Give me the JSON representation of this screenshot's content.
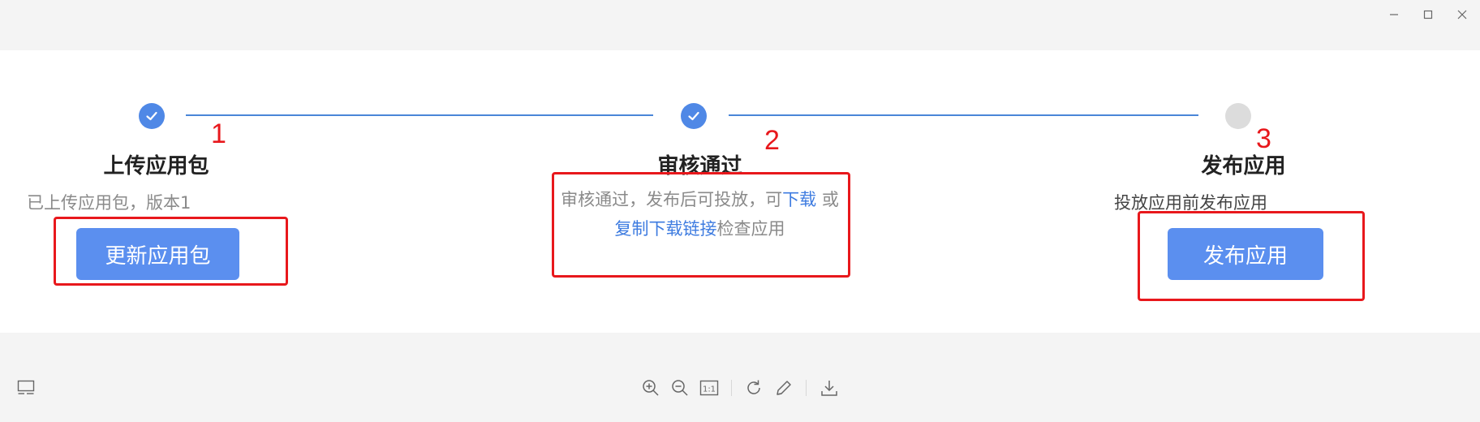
{
  "steps": [
    {
      "title": "上传应用包",
      "description": "已上传应用包，版本1",
      "button_label": "更新应用包",
      "status": "done",
      "annotation": "1"
    },
    {
      "title": "审核通过",
      "description_prefix": "审核通过，发布后可投放，可",
      "link_download": "下载",
      "description_or": " 或 ",
      "link_copy": "复制下载链接",
      "description_suffix": "检查应用",
      "status": "done",
      "annotation": "2"
    },
    {
      "title": "发布应用",
      "description": "投放应用前发布应用",
      "button_label": "发布应用",
      "status": "todo",
      "annotation": "3"
    }
  ],
  "colors": {
    "accent": "#4f88e6",
    "button": "#5b8fef",
    "link": "#3d7be0",
    "annotation": "#e8181c",
    "inactive": "#dcdcdc"
  },
  "toolbar": {
    "icons": [
      "panel-icon",
      "zoom-in-icon",
      "zoom-out-icon",
      "actual-size-icon",
      "rotate-icon",
      "edit-icon",
      "download-icon"
    ],
    "actual_size_label": "1:1"
  },
  "window": {
    "icons": [
      "minimize-icon",
      "maximize-icon",
      "close-icon"
    ]
  }
}
